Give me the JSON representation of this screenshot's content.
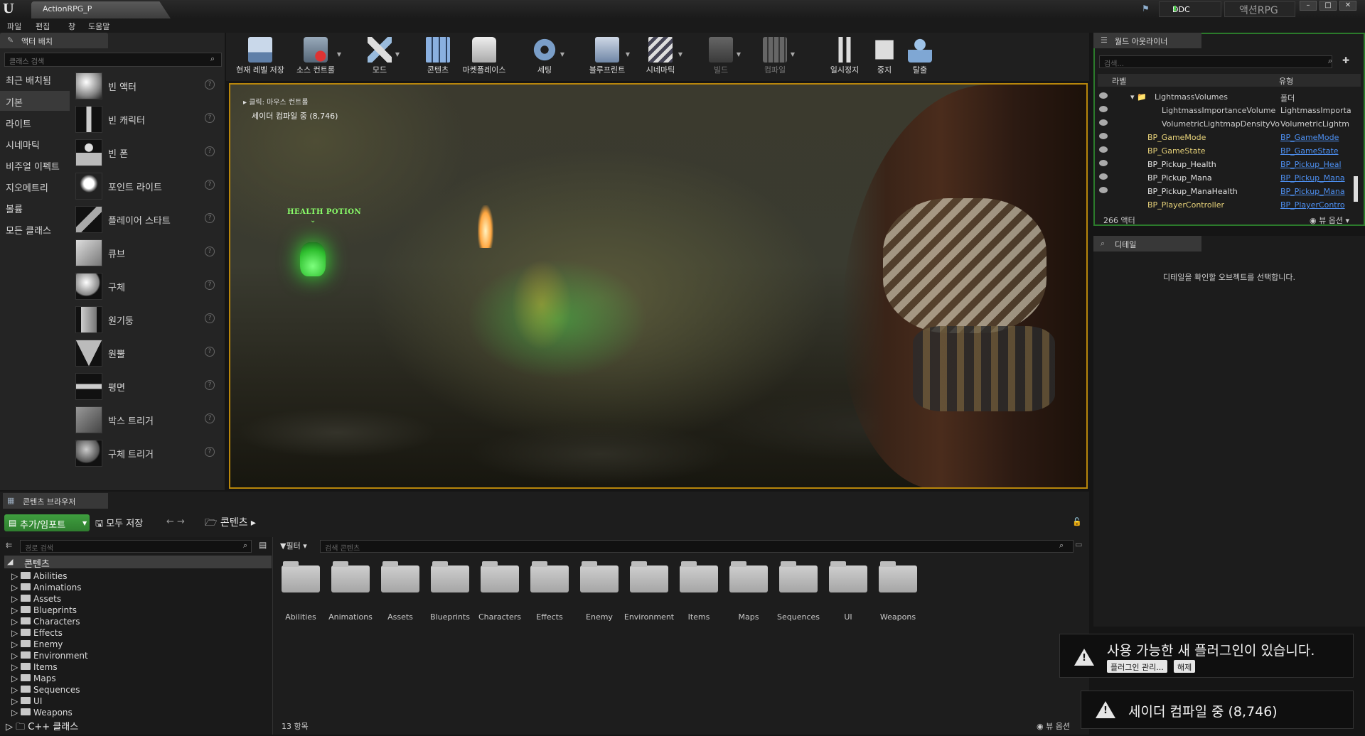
{
  "titlebar": {
    "tab_title": "ActionRPG_P",
    "ddc_label": "DDC",
    "project_name": "액션RPG",
    "win_min": "–",
    "win_max": "□",
    "win_close": "✕"
  },
  "menu": {
    "items": [
      "파일",
      "편집",
      "창",
      "도움말"
    ]
  },
  "left_panel": {
    "tab_title": "액터 배치",
    "search_placeholder": "클래스 검색",
    "categories": [
      {
        "label": "최근 배치됨",
        "active": false
      },
      {
        "label": "기본",
        "active": true
      },
      {
        "label": "라이트",
        "active": false
      },
      {
        "label": "시네마틱",
        "active": false
      },
      {
        "label": "비주얼 이펙트",
        "active": false
      },
      {
        "label": "지오메트리",
        "active": false
      },
      {
        "label": "볼륨",
        "active": false
      },
      {
        "label": "모든 클래스",
        "active": false
      }
    ],
    "items": [
      {
        "label": "빈 액터",
        "icon": "sphere-icon"
      },
      {
        "label": "빈 캐릭터",
        "icon": "character-icon"
      },
      {
        "label": "빈 폰",
        "icon": "pawn-icon"
      },
      {
        "label": "포인트 라이트",
        "icon": "light-bulb-icon"
      },
      {
        "label": "플레이어 스타트",
        "icon": "player-start-icon"
      },
      {
        "label": "큐브",
        "icon": "cube-icon"
      },
      {
        "label": "구체",
        "icon": "sphere-icon"
      },
      {
        "label": "원기둥",
        "icon": "cylinder-icon"
      },
      {
        "label": "원뿔",
        "icon": "cone-icon"
      },
      {
        "label": "평면",
        "icon": "plane-icon"
      },
      {
        "label": "박스 트리거",
        "icon": "box-trigger-icon"
      },
      {
        "label": "구체 트리거",
        "icon": "sphere-trigger-icon"
      }
    ],
    "help_glyph": "?"
  },
  "toolbar": {
    "tools": [
      {
        "label": "현재 레벨 저장",
        "icon": "save-icon",
        "dropdown": false,
        "disabled": false
      },
      {
        "label": "소스 컨트롤",
        "icon": "source-control-icon",
        "dropdown": true,
        "disabled": false
      },
      {
        "label": "모드",
        "icon": "modes-icon",
        "dropdown": true,
        "disabled": false
      },
      {
        "label": "콘텐츠",
        "icon": "content-icon",
        "dropdown": false,
        "disabled": false
      },
      {
        "label": "마켓플레이스",
        "icon": "marketplace-icon",
        "dropdown": false,
        "disabled": false
      },
      {
        "label": "세팅",
        "icon": "settings-icon",
        "dropdown": true,
        "disabled": false
      },
      {
        "label": "블루프린트",
        "icon": "blueprint-icon",
        "dropdown": true,
        "disabled": false
      },
      {
        "label": "시네마틱",
        "icon": "cinematics-icon",
        "dropdown": true,
        "disabled": false
      },
      {
        "label": "빌드",
        "icon": "build-icon",
        "dropdown": true,
        "disabled": true
      },
      {
        "label": "컴파일",
        "icon": "compile-icon",
        "dropdown": true,
        "disabled": true
      },
      {
        "label": "일시정지",
        "icon": "pause-icon",
        "dropdown": false,
        "disabled": false
      },
      {
        "label": "중지",
        "icon": "stop-icon",
        "dropdown": false,
        "disabled": false
      },
      {
        "label": "탈출",
        "icon": "eject-icon",
        "dropdown": false,
        "disabled": false
      }
    ]
  },
  "viewport": {
    "click_hint": "클릭: 마우스 컨트롤",
    "shader_status": "세이더 컴파일 중 (8,746)",
    "potion_label": "HEALTH POTION"
  },
  "outliner": {
    "tab_title": "월드 아웃라이너",
    "search_placeholder": "검색...",
    "col_label": "라벨",
    "col_type": "유형",
    "rows": [
      {
        "label": "LightmassVolumes",
        "type": "폴더",
        "indent": 1,
        "link": false
      },
      {
        "label": "LightmassImportanceVolume",
        "type": "LightmassImporta",
        "indent": 2,
        "link": false
      },
      {
        "label": "VolumetricLightmapDensityVo",
        "type": "VolumetricLightm",
        "indent": 2,
        "link": false
      },
      {
        "label": "BP_GameMode",
        "type": "BP_GameMode",
        "indent": 0,
        "link": true
      },
      {
        "label": "BP_GameState",
        "type": "BP_GameState",
        "indent": 0,
        "link": true
      },
      {
        "label": "BP_Pickup_Health",
        "type": "BP_Pickup_Heal",
        "indent": 0,
        "link": true
      },
      {
        "label": "BP_Pickup_Mana",
        "type": "BP_Pickup_Mana",
        "indent": 0,
        "link": true
      },
      {
        "label": "BP_Pickup_ManaHealth",
        "type": "BP_Pickup_Mana",
        "indent": 0,
        "link": true
      },
      {
        "label": "BP_PlayerController",
        "type": "BP_PlayerContro",
        "indent": 0,
        "link": true
      }
    ],
    "actor_count": "266 액터",
    "view_options": "뷰 옵션"
  },
  "details": {
    "tab_title": "디테일",
    "empty_message": "디테일을 확인할 오브젝트를 선택합니다."
  },
  "content_browser": {
    "tab_title": "콘텐츠 브라우저",
    "add_import": "추가/임포트",
    "save_all": "모두 저장",
    "path_root": "콘텐츠",
    "path_search_placeholder": "경로 검색",
    "tree_root": "콘텐츠",
    "folders": [
      "Abilities",
      "Animations",
      "Assets",
      "Blueprints",
      "Characters",
      "Effects",
      "Enemy",
      "Environment",
      "Items",
      "Maps",
      "Sequences",
      "UI",
      "Weapons"
    ],
    "cpp_classes": "C++ 클래스",
    "filter": "필터",
    "search_placeholder": "검색 콘텐츠",
    "item_count": "13 항목",
    "view_options": "뷰 옵션"
  },
  "notifications": {
    "plugin_message": "사용 가능한 새 플러그인이 있습니다.",
    "manage_plugins": "플러그인 관리...",
    "dismiss": "해제",
    "shader_message": "세이더 컴파일 중 (8,746)"
  },
  "colors": {
    "accent_green": "#3f9f3f",
    "viewport_border": "#b8860b",
    "link_blue": "#4d8ff0"
  }
}
